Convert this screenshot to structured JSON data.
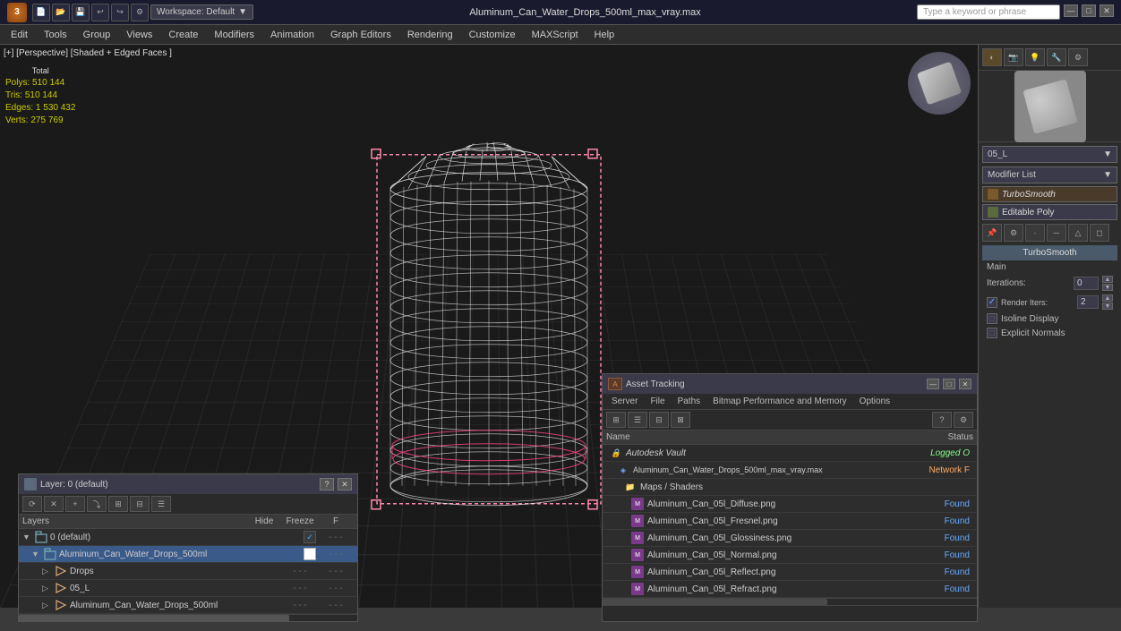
{
  "titlebar": {
    "title": "Aluminum_Can_Water_Drops_500ml_max_vray.max",
    "workspace": "Workspace: Default",
    "search_placeholder": "Type a keyword or phrase",
    "minimize": "—",
    "maximize": "□",
    "close": "✕"
  },
  "menubar": {
    "items": [
      "Edit",
      "Tools",
      "Group",
      "Views",
      "Create",
      "Modifiers",
      "Animation",
      "Graph Editors",
      "Rendering",
      "Customize",
      "MAXScript",
      "Help"
    ]
  },
  "viewport": {
    "label": "[+] [Perspective] [Shaded + Edged Faces ]",
    "stats": {
      "polys_label": "Polys:",
      "polys_total": "Total",
      "polys_value": "510 144",
      "tris_label": "Tris:",
      "tris_value": "510 144",
      "edges_label": "Edges:",
      "edges_value": "1 530 432",
      "verts_label": "Verts:",
      "verts_value": "275 769"
    }
  },
  "right_panel": {
    "obj_name": "05_L",
    "modifier_list_label": "Modifier List",
    "modifiers": [
      {
        "name": "TurboSmooth",
        "italic": true
      },
      {
        "name": "Editable Poly",
        "italic": false
      }
    ],
    "turbosmooth": {
      "title": "TurboSmooth",
      "main_label": "Main",
      "iterations_label": "Iterations:",
      "iterations_value": "0",
      "render_iters_label": "Render Iters:",
      "render_iters_value": "2",
      "isoline_display": "Isoline Display",
      "explicit_normals": "Explicit Normals"
    }
  },
  "layer_panel": {
    "title": "Layer: 0 (default)",
    "columns": {
      "name": "Layers",
      "hide": "Hide",
      "freeze": "Freeze",
      "f": "F"
    },
    "layers": [
      {
        "indent": 0,
        "name": "0 (default)",
        "type": "layer",
        "active": true,
        "check": true
      },
      {
        "indent": 1,
        "name": "Aluminum_Can_Water_Drops_500ml",
        "type": "layer",
        "selected": true
      },
      {
        "indent": 2,
        "name": "Drops",
        "type": "sub"
      },
      {
        "indent": 2,
        "name": "05_L",
        "type": "sub"
      },
      {
        "indent": 2,
        "name": "Aluminum_Can_Water_Drops_500ml",
        "type": "sub"
      }
    ]
  },
  "asset_panel": {
    "title": "Asset Tracking",
    "menus": [
      "Server",
      "File",
      "Paths",
      "Bitmap Performance and Memory",
      "Options"
    ],
    "columns": {
      "name": "Name",
      "status": "Status"
    },
    "rows": [
      {
        "indent": 0,
        "icon": "vault",
        "name": "Autodesk Vault",
        "status": "Logged O",
        "status_class": "logged"
      },
      {
        "indent": 1,
        "icon": "file",
        "name": "Aluminum_Can_Water_Drops_500ml_max_vray.max",
        "status": "Network F",
        "status_class": "network"
      },
      {
        "indent": 2,
        "icon": "folder",
        "name": "Maps / Shaders",
        "status": "",
        "status_class": ""
      },
      {
        "indent": 3,
        "icon": "map",
        "name": "Aluminum_Can_05l_Diffuse.png",
        "status": "Found",
        "status_class": "found"
      },
      {
        "indent": 3,
        "icon": "map",
        "name": "Aluminum_Can_05l_Fresnel.png",
        "status": "Found",
        "status_class": "found"
      },
      {
        "indent": 3,
        "icon": "map",
        "name": "Aluminum_Can_05l_Glossiness.png",
        "status": "Found",
        "status_class": "found"
      },
      {
        "indent": 3,
        "icon": "map",
        "name": "Aluminum_Can_05l_Normal.png",
        "status": "Found",
        "status_class": "found"
      },
      {
        "indent": 3,
        "icon": "map",
        "name": "Aluminum_Can_05l_Reflect.png",
        "status": "Found",
        "status_class": "found"
      },
      {
        "indent": 3,
        "icon": "map",
        "name": "Aluminum_Can_05l_Refract.png",
        "status": "Found",
        "status_class": "found"
      }
    ]
  }
}
